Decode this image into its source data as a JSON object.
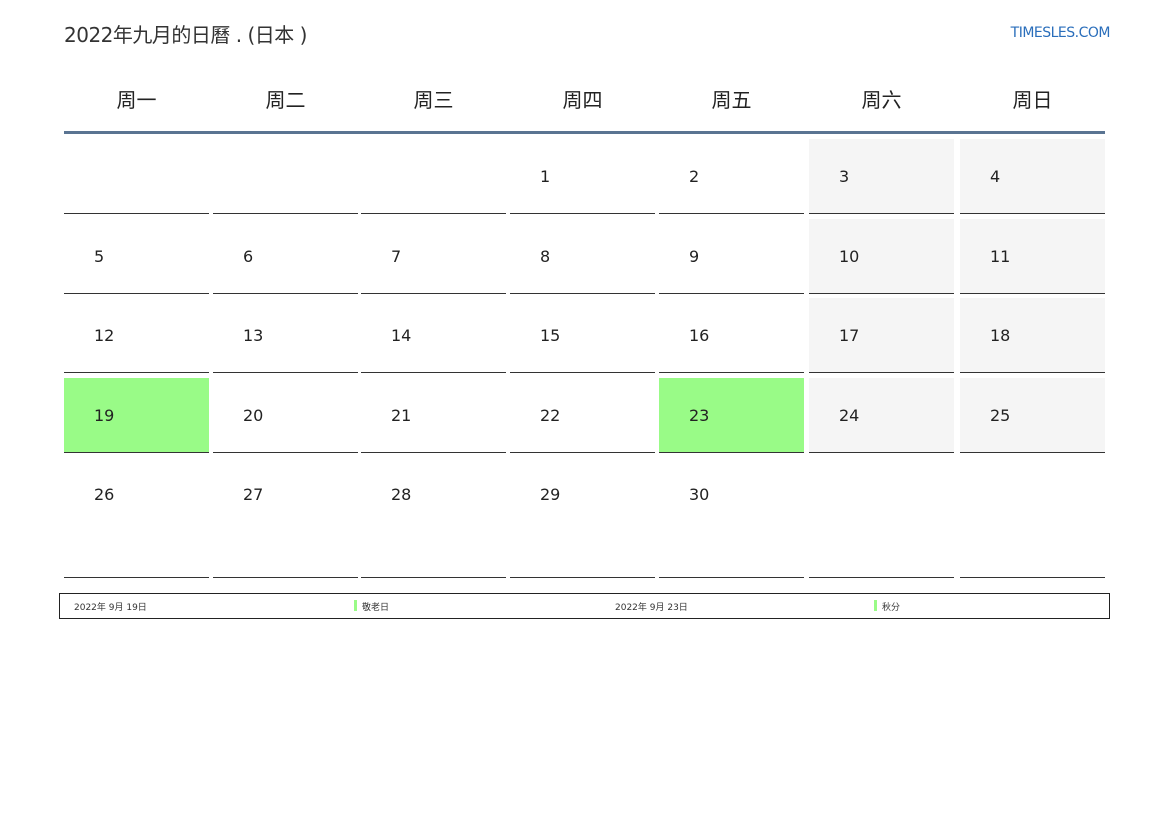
{
  "header": {
    "title": "2022年九月的日曆 . (日本 )",
    "site": "TIMESLES.COM"
  },
  "weekdays": [
    "周一",
    "周二",
    "周三",
    "周四",
    "周五",
    "周六",
    "周日"
  ],
  "weeks": [
    [
      "",
      "",
      "",
      "1",
      "2",
      "3",
      "4"
    ],
    [
      "5",
      "6",
      "7",
      "8",
      "9",
      "10",
      "11"
    ],
    [
      "12",
      "13",
      "14",
      "15",
      "16",
      "17",
      "18"
    ],
    [
      "19",
      "20",
      "21",
      "22",
      "23",
      "24",
      "25"
    ],
    [
      "26",
      "27",
      "28",
      "29",
      "30",
      "",
      ""
    ]
  ],
  "holidays": [
    {
      "date": "2022年 9月 19日",
      "name": "敬老日",
      "day": "19"
    },
    {
      "date": "2022年 9月 23日",
      "name": "秋分",
      "day": "23"
    }
  ],
  "colors": {
    "holiday": "#99fb87",
    "weekend": "#f5f5f5",
    "header_rule": "#5a7492",
    "site_link": "#2a6ebb"
  }
}
